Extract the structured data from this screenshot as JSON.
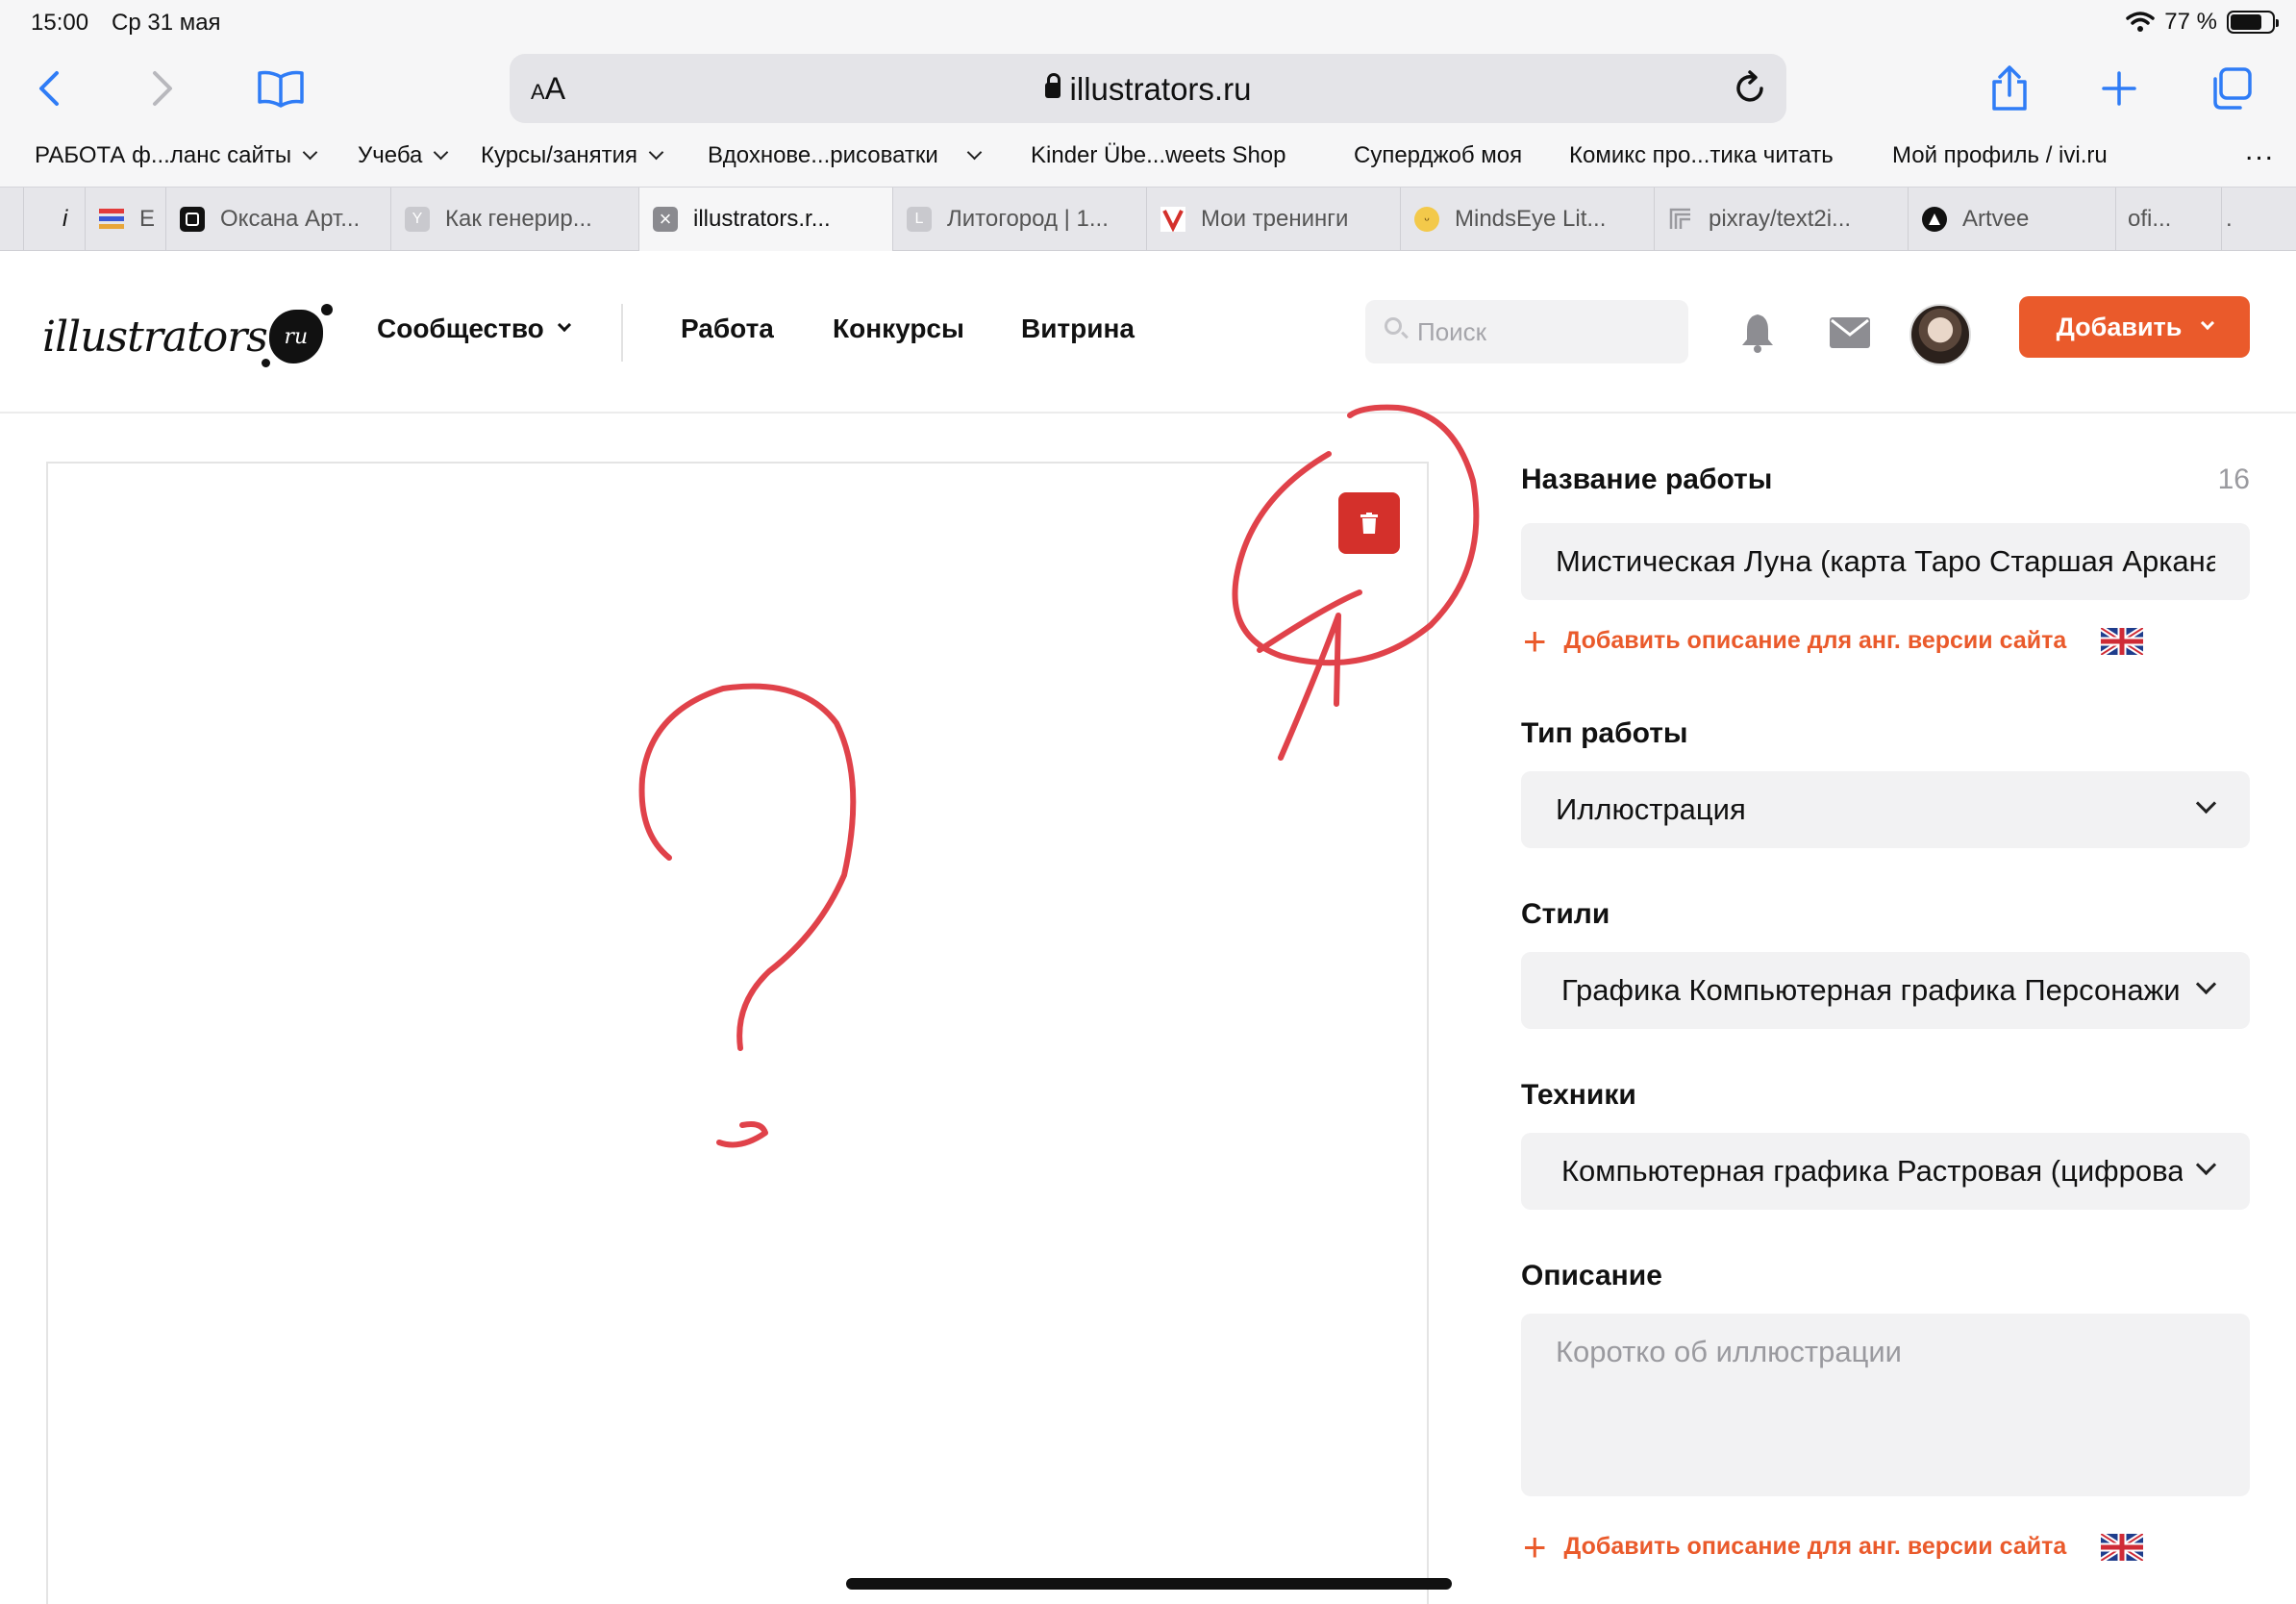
{
  "status_bar": {
    "time": "15:00",
    "date": "Ср 31 мая",
    "battery": "77 %",
    "battery_level": 0.77
  },
  "browser": {
    "text_size_label": "AA",
    "url": "illustrators.ru",
    "bookmarks": [
      {
        "label": "РАБОТА ф...ланс сайты",
        "has_menu": true
      },
      {
        "label": "Учеба",
        "has_menu": true
      },
      {
        "label": "Курсы/занятия",
        "has_menu": true
      },
      {
        "label": "Вдохнове...рисоватки",
        "has_menu": true
      },
      {
        "label": "Kinder Übe...weets Shop",
        "has_menu": false
      },
      {
        "label": "Суперджоб моя",
        "has_menu": false
      },
      {
        "label": "Комикс про...тика читать",
        "has_menu": false
      },
      {
        "label": "Мой профиль / ivi.ru",
        "has_menu": false
      }
    ],
    "more_label": "...",
    "tabs": [
      {
        "label": "i",
        "favicon": "generic-icon",
        "active": false
      },
      {
        "label": "E",
        "favicon": "stack-icon",
        "active": false
      },
      {
        "label": "Оксана Арт...",
        "favicon": "square-icon",
        "active": false
      },
      {
        "label": "Как генерир...",
        "favicon": "y-icon",
        "active": false
      },
      {
        "label": "illustrators.r...",
        "favicon": "x-icon",
        "active": true
      },
      {
        "label": "Литогород | 1...",
        "favicon": "l-icon",
        "active": false
      },
      {
        "label": "Мои тренинги",
        "favicon": "v-icon",
        "active": false
      },
      {
        "label": "MindsEye Lit...",
        "favicon": "emoji-icon",
        "active": false
      },
      {
        "label": "pixray/text2i...",
        "favicon": "p-icon",
        "active": false
      },
      {
        "label": "Artvee",
        "favicon": "a-icon",
        "active": false
      },
      {
        "label": "ofi...",
        "favicon": "none",
        "active": false
      },
      {
        "label": ".",
        "favicon": "none",
        "active": false
      }
    ]
  },
  "site": {
    "logo_text": "illustrators",
    "logo_badge": "ru",
    "nav": {
      "community": "Сообщество",
      "work": "Работа",
      "contests": "Конкурсы",
      "showcase": "Витрина"
    },
    "search_placeholder": "Поиск",
    "add_button": "Добавить"
  },
  "form": {
    "title_label": "Название работы",
    "title_counter": "16",
    "title_value": "Мистическая Луна (карта Таро Старшая Аркана)",
    "add_en_description": "Добавить описание для анг. версии сайта",
    "type_label": "Тип работы",
    "type_value": "Иллюстрация",
    "styles_label": "Стили",
    "styles_value": "Графика Компьютерная графика Персонажи",
    "techniques_label": "Техники",
    "techniques_value": "Компьютерная графика Растровая (цифровая)",
    "description_label": "Описание",
    "description_placeholder": "Коротко об иллюстрации",
    "add_en_description_2": "Добавить описание для анг. версии сайта"
  },
  "colors": {
    "accent": "#ea5a2b",
    "delete": "#d4302b",
    "ink": "#e0424a",
    "ios_blue": "#2f7cf6"
  }
}
